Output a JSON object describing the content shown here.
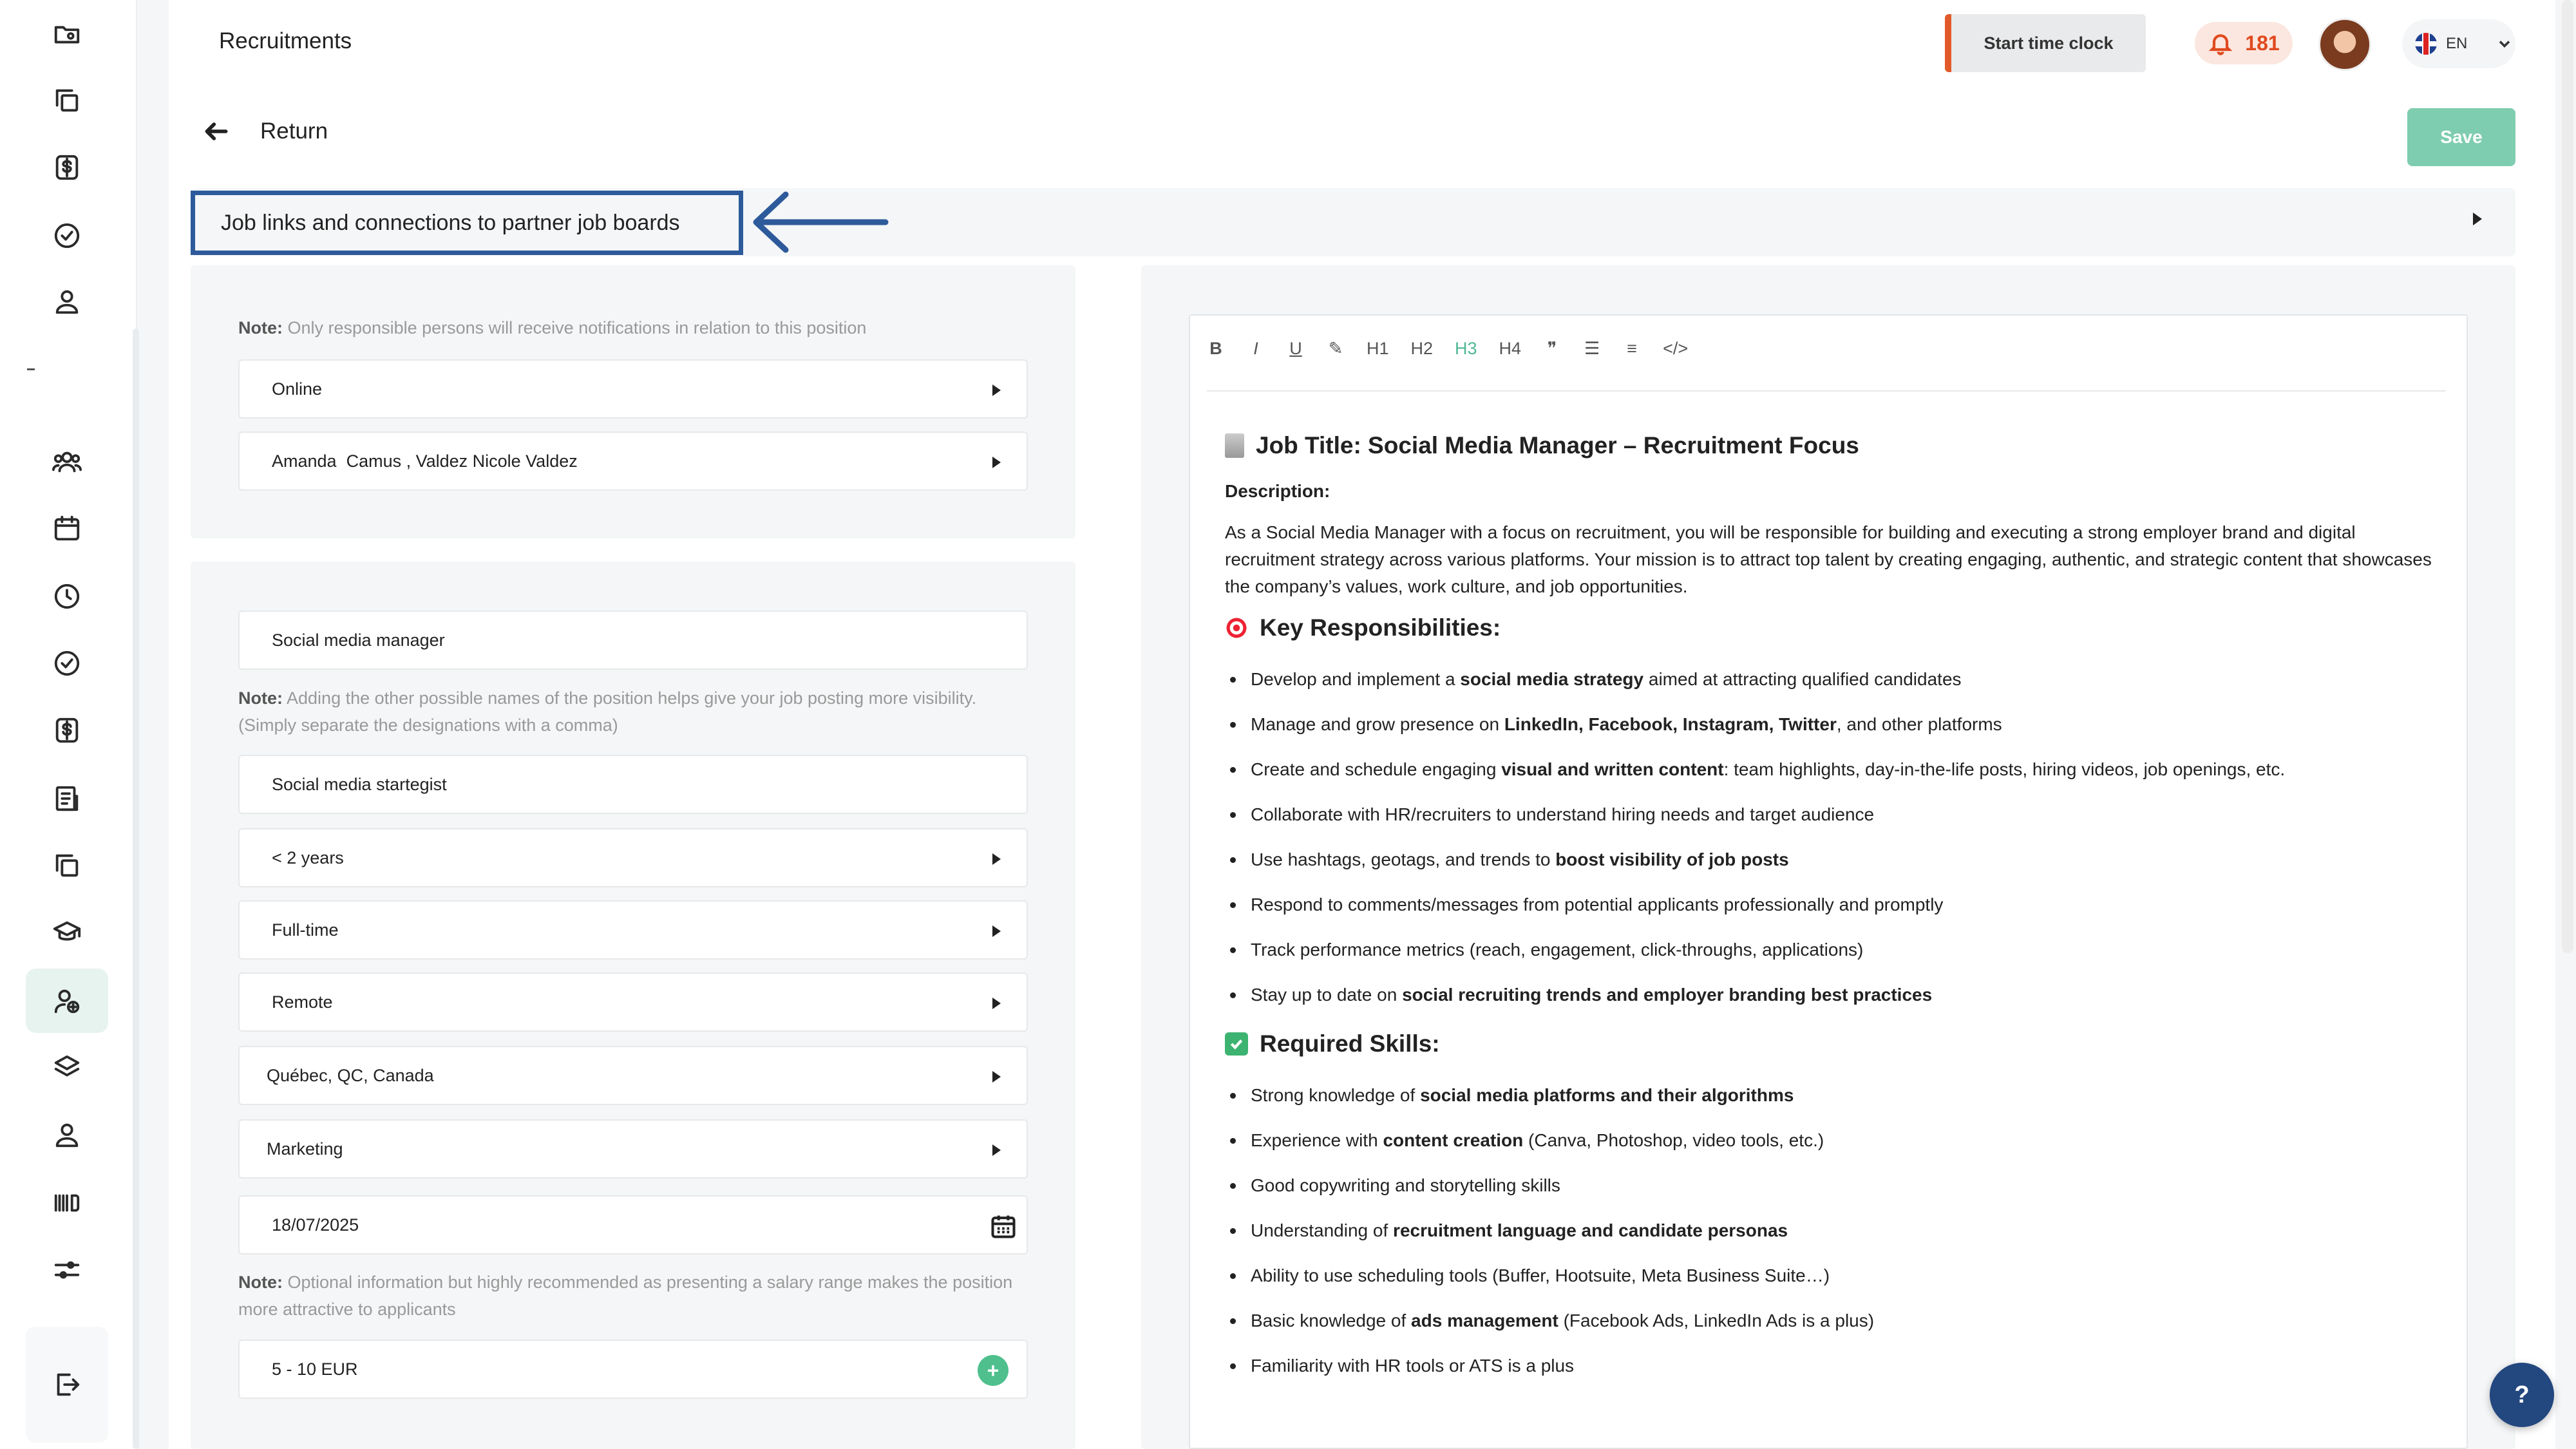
{
  "header": {
    "title": "Recruitments",
    "clock_button": "Start time clock",
    "notifications_count": "181",
    "language": "EN"
  },
  "nav": {
    "return_label": "Return",
    "save_label": "Save"
  },
  "accordion": {
    "title": "Job links and connections to partner job boards"
  },
  "panel1": {
    "note_bold": "Note:",
    "note_text": " Only responsible persons will receive notifications in relation to this position",
    "status": "Online",
    "responsible": "Amanda  Camus , Valdez Nicole Valdez"
  },
  "panel2": {
    "position_name": "Social media manager",
    "note_bold": "Note:",
    "note_text": " Adding the other possible names of the position helps give your job posting more visibility. (Simply separate the designations with a comma)",
    "alt_names": "Social media startegist",
    "experience": "< 2 years",
    "contract_type": "Full-time",
    "work_mode": "Remote",
    "location": "Québec, QC, Canada",
    "department": "Marketing",
    "date": "18/07/2025",
    "salary_note_bold": "Note:",
    "salary_note_text": " Optional information but highly recommended as presenting a salary range makes the position more attractive to applicants",
    "salary": "5 - 10 EUR"
  },
  "editor": {
    "toolbar": [
      "B",
      "I",
      "U",
      "✎",
      "H1",
      "H2",
      "H3",
      "H4",
      "❞",
      "☰",
      "≡",
      "</>"
    ],
    "active_tool": "H3",
    "job_title": "Job Title: Social Media Manager – Recruitment Focus",
    "description_label": "Description:",
    "description": "As a Social Media Manager with a focus on recruitment, you will be responsible for building and executing a strong employer brand and digital recruitment strategy across various platforms. Your mission is to attract top talent by creating engaging, authentic, and strategic content that showcases the company’s values, work culture, and job opportunities.",
    "responsibilities_heading": "Key Responsibilities:",
    "responsibilities": [
      {
        "pre": "Develop and implement a ",
        "bold": "social media strategy",
        "post": " aimed at attracting qualified candidates"
      },
      {
        "pre": "Manage and grow presence on ",
        "bold": "LinkedIn, Facebook, Instagram, Twitter",
        "post": ", and other platforms"
      },
      {
        "pre": "Create and schedule engaging ",
        "bold": "visual and written content",
        "post": ": team highlights, day-in-the-life posts, hiring videos, job openings, etc."
      },
      {
        "pre": "Collaborate with HR/recruiters to understand hiring needs and target audience",
        "bold": "",
        "post": ""
      },
      {
        "pre": "Use hashtags, geotags, and trends to ",
        "bold": "boost visibility of job posts",
        "post": ""
      },
      {
        "pre": "Respond to comments/messages from potential applicants professionally and promptly",
        "bold": "",
        "post": ""
      },
      {
        "pre": "Track performance metrics (reach, engagement, click-throughs, applications)",
        "bold": "",
        "post": ""
      },
      {
        "pre": "Stay up to date on ",
        "bold": "social recruiting trends and employer branding best practices",
        "post": ""
      }
    ],
    "skills_heading": "Required Skills:",
    "skills": [
      {
        "pre": "Strong knowledge of ",
        "bold": "social media platforms and their algorithms",
        "post": ""
      },
      {
        "pre": "Experience with ",
        "bold": "content creation",
        "post": " (Canva, Photoshop, video tools, etc.)"
      },
      {
        "pre": "Good copywriting and storytelling skills",
        "bold": "",
        "post": ""
      },
      {
        "pre": "Understanding of ",
        "bold": "recruitment language and candidate personas",
        "post": ""
      },
      {
        "pre": "Ability to use scheduling tools (Buffer, Hootsuite, Meta Business Suite…)",
        "bold": "",
        "post": ""
      },
      {
        "pre": "Basic knowledge of ",
        "bold": "ads management",
        "post": " (Facebook Ads, LinkedIn Ads is a plus)"
      },
      {
        "pre": "Familiarity with HR tools or ATS is a plus",
        "bold": "",
        "post": ""
      }
    ]
  },
  "help_label": "?",
  "sidebar_icons": [
    "folder-user-icon",
    "copy-icon",
    "dollar-icon",
    "check-circle-icon",
    "user-icon",
    "users-icon",
    "calendar-icon",
    "clock-icon",
    "check-circle-icon",
    "dollar-icon",
    "document-list-icon",
    "copy-icon",
    "graduation-cap-icon",
    "user-plus-icon",
    "layers-icon",
    "user-icon",
    "barcode-icon",
    "sliders-icon",
    "logout-icon"
  ]
}
